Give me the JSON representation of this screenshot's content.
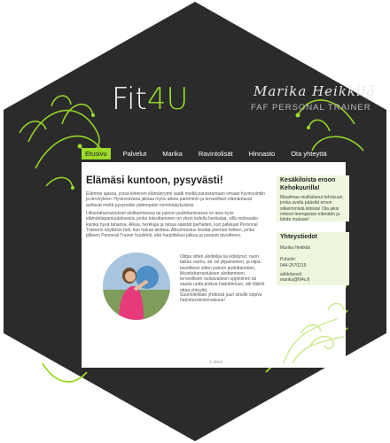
{
  "brand": {
    "logo_main": "Fit",
    "logo_accent": "4U",
    "trainer_name": "Marika Heikkilä",
    "trainer_title": "FAF PERSONAL TRAINER"
  },
  "colors": {
    "accent": "#9bdc2a",
    "background": "#2a2a2a",
    "sidebar": "#eef7dd"
  },
  "nav": {
    "items": [
      "Etusivu",
      "Palvelut",
      "Marika",
      "Ravintolisät",
      "Hinnasto",
      "Ota yhteyttä"
    ],
    "active": "Etusivu"
  },
  "main": {
    "title": "Elämäsi kuntoon, pysyvästi!",
    "p1": "Elämme ajassa, jossa kiireinen elämänrytmi vaatii meiltä panostamaan omaan hyvinvointiin ja terveyteen. Hyvinvoivana jaksaa myös arkea paremmin ja terveelliset elämäntavat auttavat meitä pysymään pidempään toimintakykyisinä.",
    "p2": "Liikuntaharrastukset aloittamisessa tai painon pudottamisessa on aina kyse elämäntapamuutoksesta, jonka toteuttaminen on yksin todella hankalaa, sillä motivaatio kuinka hyvä tahansa. Alkaa, herkkuja ja rahaa säästät parhaiten, kun palkkaat Personal Trainerin käyttöösi heti, kun haluat aloittaa. Alkuinnostus kestää yleensä hetken, jonka jälkeen Personal Trainer huolehtii, että harjoittelusi jatkuu ja paraset tavoitteesi.",
    "p3": "Olitpa sitten aloittelija tai edistynyt, nuori taikka vanha, ali- tai ylipainoinen, ja olipa tavoitteesi sitten painon pudottaminen, liikuntaharrastuksen aloittaminen, terveellisen ruokavalioon oppiminen tai saada uutta potkua harjoitteluun, äiti öljäröt ottaa yhteyttä.",
    "p4": "Suunnitellaan yhdessä juuri sinulle sopiva harjoitusokokonaisuus!"
  },
  "sidebar": {
    "promo_title": "Kesäkiloista eroon Kehokuurilla!",
    "promo_text": "Maailmaa muiltsitanut tehokuuri, jonka avulla päästät eroon sitkeimmistä kiloista! Ota aiksi onkeet teemppäan elämään ja lähde mukaan!",
    "contact_title": "Yhteystiedot",
    "contact_name": "Marika Heikkilä",
    "phone_label": "Puhelin:",
    "phone": "044-2570215",
    "email_label": "sähköposti:",
    "email": "marika@fit4u.fi"
  },
  "footer": {
    "copyright": "© 2013"
  },
  "icons": {
    "photo": "trainer-photo"
  }
}
